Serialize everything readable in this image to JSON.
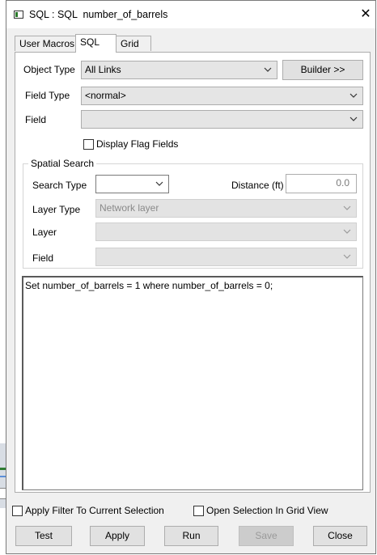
{
  "window": {
    "title": "SQL : SQL  number_of_barrels",
    "close_glyph": "✕"
  },
  "tabs": [
    {
      "label": "User Macros"
    },
    {
      "label": "SQL"
    },
    {
      "label": "Grid"
    }
  ],
  "form": {
    "object_type": {
      "label": "Object Type",
      "value": "All Links"
    },
    "builder_button": "Builder >>",
    "field_type": {
      "label": "Field Type",
      "value": "<normal>"
    },
    "field": {
      "label": "Field",
      "value": ""
    },
    "display_flag_fields": {
      "label": "Display Flag Fields",
      "checked": false
    }
  },
  "spatial_search": {
    "title": "Spatial Search",
    "search_type": {
      "label": "Search Type",
      "value": ""
    },
    "distance": {
      "label": "Distance (ft)",
      "value": "0.0"
    },
    "layer_type": {
      "label": "Layer Type",
      "value": "Network layer"
    },
    "layer": {
      "label": "Layer",
      "value": ""
    },
    "field": {
      "label": "Field",
      "value": ""
    }
  },
  "sql_text": "Set number_of_barrels = 1 where number_of_barrels = 0;",
  "options": {
    "apply_filter": {
      "label": "Apply Filter To Current Selection",
      "checked": false
    },
    "open_selection": {
      "label": "Open Selection In Grid View",
      "checked": false
    }
  },
  "buttons": {
    "test": "Test",
    "apply": "Apply",
    "run": "Run",
    "save": "Save",
    "close": "Close"
  },
  "icons": {
    "window_icon": "app-window-icon",
    "close": "close-icon",
    "dropdown": "chevron-down-icon"
  }
}
